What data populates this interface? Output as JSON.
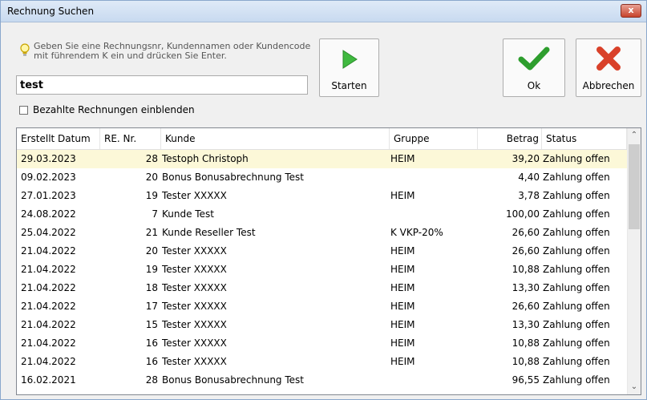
{
  "window": {
    "title": "Rechnung Suchen",
    "close_label": "x"
  },
  "hint": {
    "icon": "lightbulb-icon",
    "text": "Geben Sie eine Rechnungsnr, Kundennamen oder Kundencode mit führendem K ein und drücken Sie Enter."
  },
  "search": {
    "value": "test"
  },
  "buttons": {
    "start": "Starten",
    "ok": "Ok",
    "cancel": "Abbrechen"
  },
  "options": {
    "show_paid_label": "Bezahlte Rechnungen einblenden",
    "show_paid_checked": false
  },
  "table": {
    "columns": [
      "Erstellt Datum",
      "RE. Nr.",
      "Kunde",
      "Gruppe",
      "Betrag",
      "Status"
    ],
    "rows": [
      {
        "date": "29.03.2023",
        "nr": "28",
        "kunde": "Testoph Christoph",
        "gruppe": "HEIM",
        "betrag": "39,20",
        "status": "Zahlung offen"
      },
      {
        "date": "09.02.2023",
        "nr": "20",
        "kunde": "Bonus Bonusabrechnung Test",
        "gruppe": "",
        "betrag": "4,40",
        "status": "Zahlung offen"
      },
      {
        "date": "27.01.2023",
        "nr": "19",
        "kunde": "Tester XXXXX",
        "gruppe": "HEIM",
        "betrag": "3,78",
        "status": "Zahlung offen"
      },
      {
        "date": "24.08.2022",
        "nr": "7",
        "kunde": "Kunde Test",
        "gruppe": "",
        "betrag": "100,00",
        "status": "Zahlung offen"
      },
      {
        "date": "25.04.2022",
        "nr": "21",
        "kunde": "Kunde Reseller Test",
        "gruppe": "K VKP-20%",
        "betrag": "26,60",
        "status": "Zahlung offen"
      },
      {
        "date": "21.04.2022",
        "nr": "20",
        "kunde": "Tester XXXXX",
        "gruppe": "HEIM",
        "betrag": "26,60",
        "status": "Zahlung offen"
      },
      {
        "date": "21.04.2022",
        "nr": "19",
        "kunde": "Tester XXXXX",
        "gruppe": "HEIM",
        "betrag": "10,88",
        "status": "Zahlung offen"
      },
      {
        "date": "21.04.2022",
        "nr": "18",
        "kunde": "Tester XXXXX",
        "gruppe": "HEIM",
        "betrag": "13,30",
        "status": "Zahlung offen"
      },
      {
        "date": "21.04.2022",
        "nr": "17",
        "kunde": "Tester XXXXX",
        "gruppe": "HEIM",
        "betrag": "26,60",
        "status": "Zahlung offen"
      },
      {
        "date": "21.04.2022",
        "nr": "15",
        "kunde": "Tester XXXXX",
        "gruppe": "HEIM",
        "betrag": "13,30",
        "status": "Zahlung offen"
      },
      {
        "date": "21.04.2022",
        "nr": "16",
        "kunde": "Tester XXXXX",
        "gruppe": "HEIM",
        "betrag": "10,88",
        "status": "Zahlung offen"
      },
      {
        "date": "21.04.2022",
        "nr": "16",
        "kunde": "Tester XXXXX",
        "gruppe": "HEIM",
        "betrag": "10,88",
        "status": "Zahlung offen"
      },
      {
        "date": "16.02.2021",
        "nr": "28",
        "kunde": "Bonus Bonusabrechnung Test",
        "gruppe": "",
        "betrag": "96,55",
        "status": "Zahlung offen"
      }
    ],
    "selected_row": 0
  },
  "colors": {
    "selected_row": "#fcf8d8",
    "start_icon": "#3fb93f",
    "ok_icon": "#2e9e2e",
    "cancel_icon": "#d9412a"
  }
}
